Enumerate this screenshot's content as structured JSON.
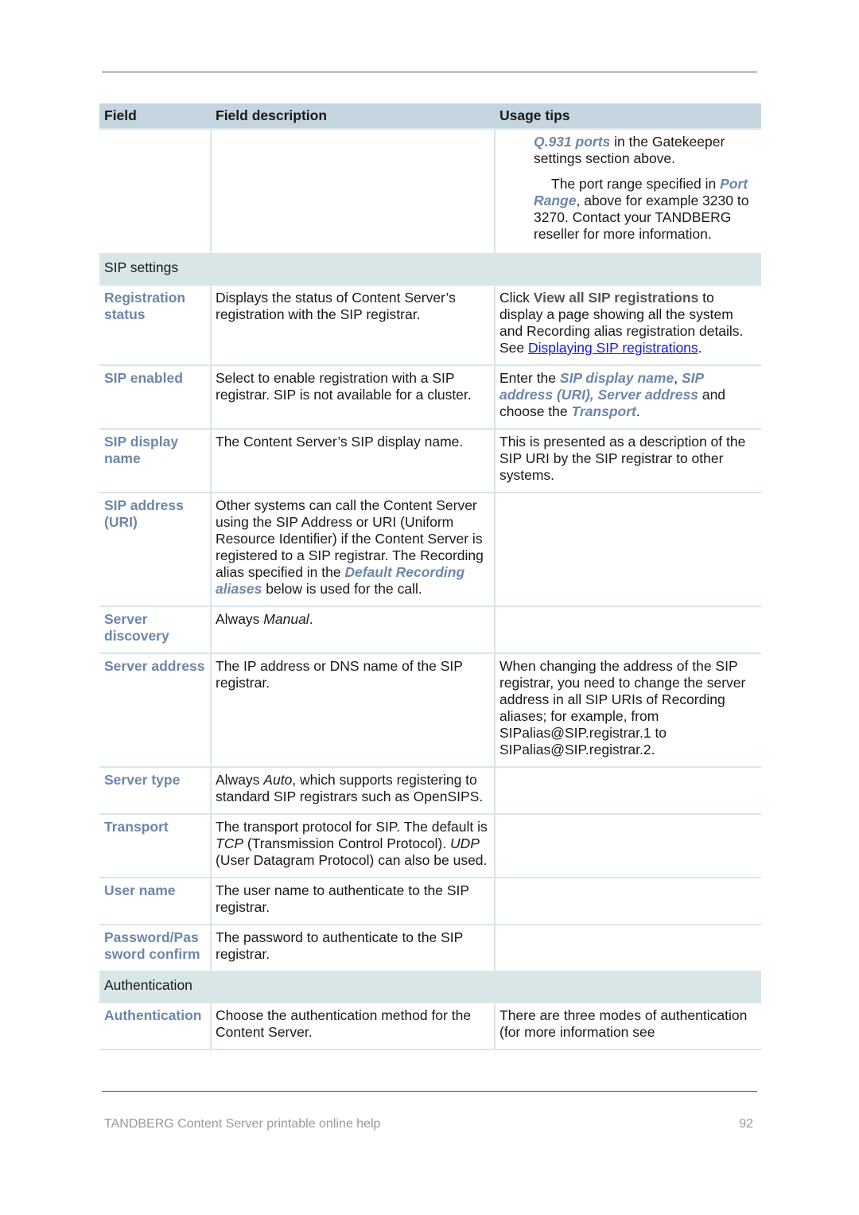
{
  "header": {
    "columns": [
      "Field",
      "Field description",
      "Usage tips"
    ]
  },
  "continuation": {
    "tip_p1_ref": "Q.931 ports",
    "tip_p1_text": " in the Gatekeeper settings section above.",
    "tip_p2_pre": "The port range specified in ",
    "tip_p2_ref": "Port Range",
    "tip_p2_post": ", above for example 3230 to 3270. Contact your TANDBERG reseller for more information."
  },
  "sections": {
    "sip": "SIP settings",
    "auth": "Authentication"
  },
  "rows": {
    "registration_status": {
      "field": "Registration status",
      "desc": "Displays the status of Content Server’s registration with the SIP registrar.",
      "tip_pre": "Click ",
      "tip_ui": "View all SIP registrations",
      "tip_mid": " to display a page showing all the system and Recording alias registration details. See ",
      "tip_link": "Displaying SIP registrations",
      "tip_post": "."
    },
    "sip_enabled": {
      "field": "SIP enabled",
      "desc": "Select to enable registration with a SIP registrar. SIP is not available for a cluster.",
      "tip_pre": "Enter the ",
      "tip_ref1": "SIP display name",
      "tip_sep": ", ",
      "tip_ref2": "SIP address (URI), Server address",
      "tip_mid": " and choose the ",
      "tip_ref3": "Transport",
      "tip_post": "."
    },
    "sip_display_name": {
      "field": "SIP display name",
      "desc": "The Content Server’s SIP display name.",
      "tip": "This is presented as a description of the SIP URI by the SIP registrar to other systems."
    },
    "sip_address": {
      "field": "SIP address (URI)",
      "desc_pre": "Other systems can call the Content Server using the SIP Address or URI (Uniform Resource Identifier) if the Content Server is registered to a SIP registrar. The Recording alias specified in the ",
      "desc_ref": "Default Recording aliases",
      "desc_post": " below is used for the call.",
      "tip": ""
    },
    "server_discovery": {
      "field": "Server discovery",
      "desc_pre": "Always ",
      "desc_em": "Manual",
      "desc_post": ".",
      "tip": ""
    },
    "server_address": {
      "field": "Server address",
      "desc": "The IP address or DNS name of the SIP registrar.",
      "tip": "When changing the address of the SIP registrar, you need to change the server address in all SIP URIs of Recording aliases; for example, from SIPalias@SIP.registrar.1 to SIPalias@SIP.registrar.2."
    },
    "server_type": {
      "field": "Server type",
      "desc_pre": "Always ",
      "desc_em": "Auto",
      "desc_post": ", which supports registering to standard SIP registrars such as OpenSIPS.",
      "tip": ""
    },
    "transport": {
      "field": "Transport",
      "desc_pre": "The transport protocol for SIP. The default is ",
      "desc_em1": "TCP",
      "desc_mid": " (Transmission Control Protocol). ",
      "desc_em2": "UDP",
      "desc_post": " (User Datagram Protocol) can also be used.",
      "tip": ""
    },
    "user_name": {
      "field": "User name",
      "desc": "The user name to authenticate to the SIP registrar.",
      "tip": ""
    },
    "password": {
      "field": "Password/Password confirm",
      "desc": "The password to authenticate to the SIP registrar.",
      "tip": ""
    },
    "authentication": {
      "field": "Authentication",
      "desc": "Choose the authentication method for the Content Server.",
      "tip": "There are three modes of authentication (for more information see"
    }
  },
  "footer": {
    "title": "TANDBERG Content Server printable online help",
    "page": "92"
  }
}
